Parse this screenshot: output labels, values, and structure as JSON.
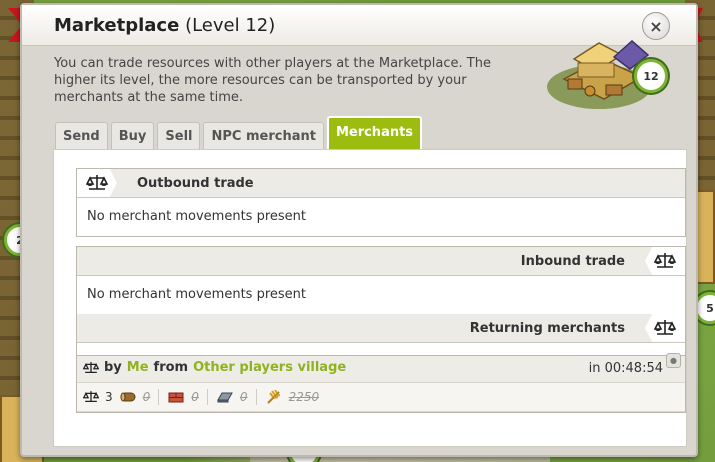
{
  "map": {
    "badges": [
      "2",
      "5",
      "5"
    ]
  },
  "dialog": {
    "title_name": "Marketplace",
    "title_level": "(Level 12)",
    "close_label": "×",
    "description": "You can trade resources with other players at the Marketplace. The higher its level, the more resources can be transported by your merchants at the same time.",
    "building_level": "12"
  },
  "tabs": [
    "Send",
    "Buy",
    "Sell",
    "NPC merchant",
    "Merchants"
  ],
  "active_tab": "Merchants",
  "outbound": {
    "title": "Outbound trade",
    "empty": "No merchant movements present"
  },
  "inbound": {
    "title": "Inbound trade",
    "empty": "No merchant movements present"
  },
  "returning": {
    "title": "Returning merchants",
    "entry": {
      "by_label": "by",
      "player": "Me",
      "from_label": "from",
      "village": "Other players village",
      "time": "in 00:48:54",
      "merchants": "3",
      "wood": "0",
      "clay": "0",
      "iron": "0",
      "crop": "2250"
    }
  },
  "colors": {
    "accent": "#9cbd0f",
    "link_green": "#8fb21f",
    "ribbon": "#c8161d"
  }
}
